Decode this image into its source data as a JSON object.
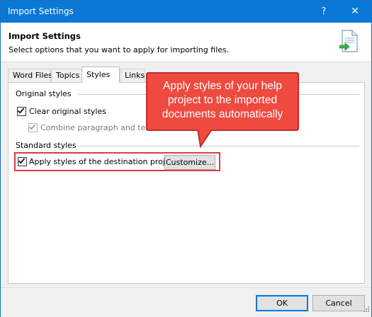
{
  "window": {
    "title": "Import Settings",
    "help_glyph": "?",
    "close_glyph": "✕"
  },
  "header": {
    "title": "Import Settings",
    "subtitle": "Select options that you want to apply for importing files.",
    "icon": "import-document-icon"
  },
  "tabs": [
    {
      "label": "Word Files",
      "active": false
    },
    {
      "label": "Topics",
      "active": false
    },
    {
      "label": "Styles",
      "active": true
    },
    {
      "label": "Links",
      "active": false
    }
  ],
  "styles_tab": {
    "original_group": "Original styles",
    "clear_original": {
      "label": "Clear original styles",
      "checked": true
    },
    "combine_paragraph": {
      "label": "Combine paragraph and text s",
      "checked": true,
      "disabled": true
    },
    "standard_group": "Standard styles",
    "apply_destination": {
      "label": "Apply styles of the destination project",
      "checked": true
    },
    "customize_label": "Customize..."
  },
  "callout": {
    "line1": "Apply styles of your help",
    "line2": "project to the imported",
    "line3": "documents automatically"
  },
  "footer": {
    "ok_label": "OK",
    "cancel_label": "Cancel"
  },
  "colors": {
    "titlebar": "#0a78d7",
    "callout_fill": "#ef4a40",
    "highlight_border": "#e03c3c"
  }
}
